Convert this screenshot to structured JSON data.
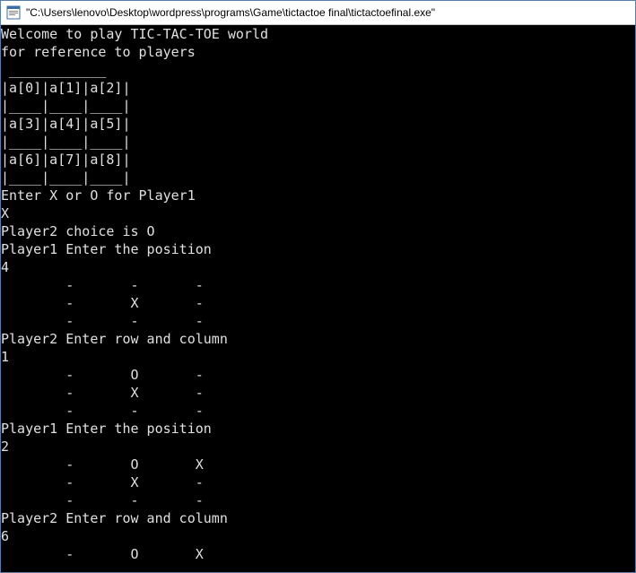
{
  "window": {
    "title_path": "\"C:\\Users\\lenovo\\Desktop\\wordpress\\programs\\Game\\tictactoe final\\tictactoefinal.exe\""
  },
  "console": {
    "lines": [
      "Welcome to play TIC-TAC-TOE world",
      "for reference to players",
      " ____________",
      "|a[0]|a[1]|a[2]|",
      "|____|____|____|",
      "|a[3]|a[4]|a[5]|",
      "|____|____|____|",
      "|a[6]|a[7]|a[8]|",
      "|____|____|____|",
      "Enter X or O for Player1",
      "X",
      "Player2 choice is O",
      "Player1 Enter the position",
      "4",
      "        -       -       -",
      "        -       X       -",
      "        -       -       -",
      "Player2 Enter row and column",
      "1",
      "        -       O       -",
      "        -       X       -",
      "        -       -       -",
      "Player1 Enter the position",
      "2",
      "        -       O       X",
      "        -       X       -",
      "        -       -       -",
      "Player2 Enter row and column",
      "6",
      "        -       O       X"
    ]
  },
  "game": {
    "reference_cells": [
      "a[0]",
      "a[1]",
      "a[2]",
      "a[3]",
      "a[4]",
      "a[5]",
      "a[6]",
      "a[7]",
      "a[8]"
    ],
    "player1_symbol": "X",
    "player2_symbol": "O",
    "moves": [
      {
        "player": 1,
        "prompt": "Player1 Enter the position",
        "input": "4"
      },
      {
        "player": 2,
        "prompt": "Player2 Enter row and column",
        "input": "1"
      },
      {
        "player": 1,
        "prompt": "Player1 Enter the position",
        "input": "2"
      },
      {
        "player": 2,
        "prompt": "Player2 Enter row and column",
        "input": "6"
      }
    ],
    "boards": [
      [
        [
          "-",
          "-",
          "-"
        ],
        [
          "-",
          "X",
          "-"
        ],
        [
          "-",
          "-",
          "-"
        ]
      ],
      [
        [
          "-",
          "O",
          "-"
        ],
        [
          "-",
          "X",
          "-"
        ],
        [
          "-",
          "-",
          "-"
        ]
      ],
      [
        [
          "-",
          "O",
          "X"
        ],
        [
          "-",
          "X",
          "-"
        ],
        [
          "-",
          "-",
          "-"
        ]
      ],
      [
        [
          "-",
          "O",
          "X"
        ]
      ]
    ]
  }
}
